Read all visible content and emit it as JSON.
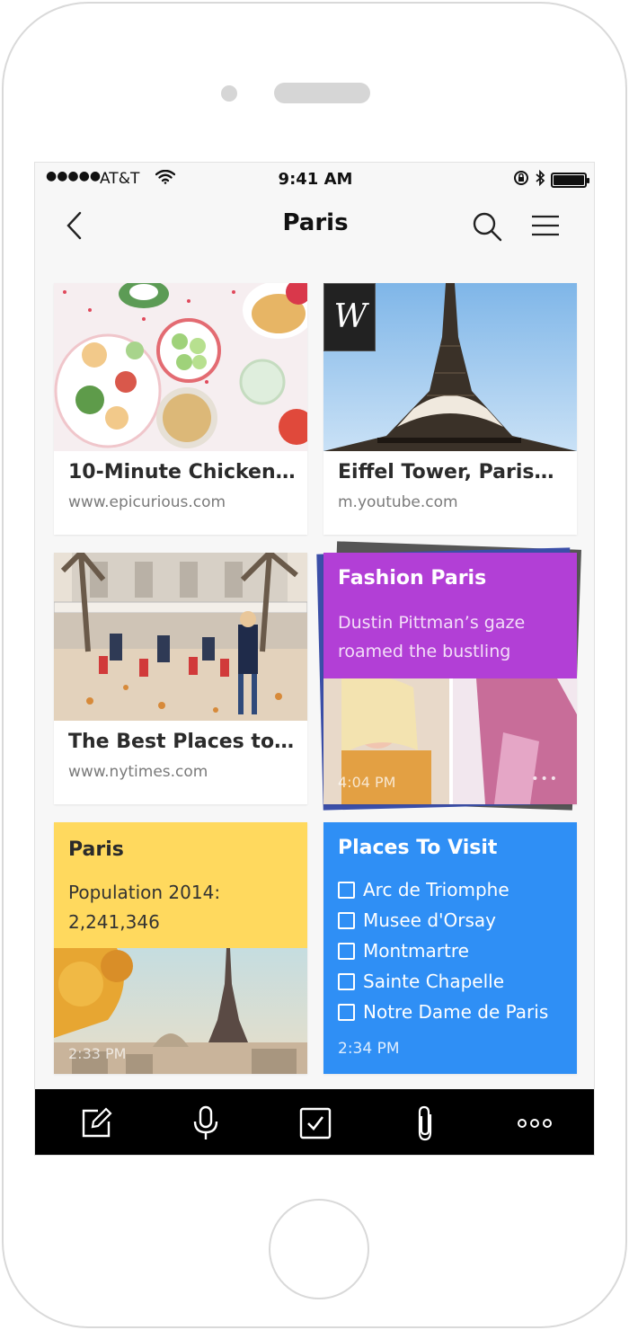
{
  "status_bar": {
    "signal_dots": "●●●●●",
    "carrier": "AT&T",
    "time": "9:41 AM",
    "battery_level": 1.0
  },
  "nav": {
    "title": "Paris",
    "back_icon": "chevron-left-icon",
    "search_icon": "search-icon",
    "menu_icon": "hamburger-menu-icon"
  },
  "cards": {
    "recipe": {
      "title": "10-Minute Chicken…",
      "url": "www.epicurious.com"
    },
    "eiffel": {
      "title": "Eiffel Tower, Paris…",
      "url": "m.youtube.com",
      "badge": "W"
    },
    "nytimes": {
      "title": "The Best Places to…",
      "url": "www.nytimes.com"
    },
    "fashion": {
      "title": "Fashion Paris",
      "body_line1": "Dustin Pittman’s gaze",
      "body_line2": "roamed the bustling",
      "time": "4:04 PM",
      "more": "•••",
      "color": "#b23fd6"
    },
    "paris_note": {
      "title": "Paris",
      "body_line1": "Population 2014:",
      "body_line2": "2,241,346",
      "time": "2:33 PM",
      "color": "#ffd95e"
    },
    "places": {
      "title": "Places To Visit",
      "items": [
        "Arc de Triomphe",
        "Musee d'Orsay",
        "Montmartre",
        "Sainte Chapelle",
        "Notre Dame de Paris"
      ],
      "time": "2:34 PM",
      "color": "#2f8ff5"
    }
  },
  "toolbar": {
    "items": [
      "compose-icon",
      "microphone-icon",
      "checkbox-icon",
      "paperclip-icon",
      "more-icon"
    ]
  }
}
